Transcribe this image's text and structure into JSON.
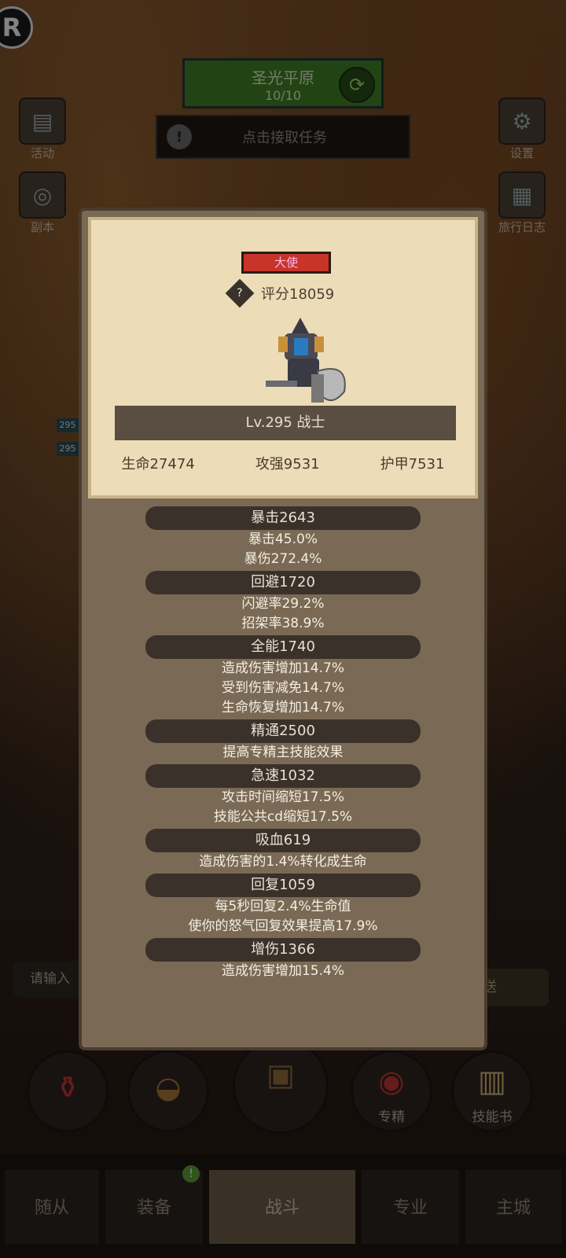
{
  "hud": {
    "zone_name": "圣光平原",
    "zone_progress": "10/10",
    "task_label": "点击接取任务",
    "left_buttons": [
      {
        "label": "活动",
        "icon": "activity-board-icon"
      },
      {
        "label": "副本",
        "icon": "dungeon-portal-icon"
      }
    ],
    "right_buttons": [
      {
        "label": "设置",
        "icon": "gear-icon"
      },
      {
        "label": "旅行日志",
        "icon": "journal-book-icon"
      }
    ],
    "level_tags": [
      "295",
      "295"
    ]
  },
  "chat": {
    "input_placeholder": "请输入",
    "send_label": "送"
  },
  "action_buttons": [
    {
      "label": "",
      "icon": "potion-icon"
    },
    {
      "label": "",
      "icon": "bread-icon"
    },
    {
      "label": "",
      "icon": "treasure-chest-icon"
    },
    {
      "label": "专精",
      "icon": "specialization-icon"
    },
    {
      "label": "技能书",
      "icon": "skill-book-icon"
    }
  ],
  "nav": {
    "tabs": [
      "随从",
      "装备",
      "战斗",
      "专业",
      "主城"
    ],
    "active_tab": "战斗",
    "badge": "!"
  },
  "popup": {
    "rank": "大使",
    "score": "评分18059",
    "level_class": "Lv.295 战士",
    "base_stats": [
      "生命27474",
      "攻强9531",
      "护甲7531"
    ],
    "stats": [
      {
        "header": "暴击2643",
        "lines": [
          "暴击45.0%",
          "暴伤272.4%"
        ]
      },
      {
        "header": "回避1720",
        "lines": [
          "闪避率29.2%",
          "招架率38.9%"
        ]
      },
      {
        "header": "全能1740",
        "lines": [
          "造成伤害增加14.7%",
          "受到伤害减免14.7%",
          "生命恢复增加14.7%"
        ]
      },
      {
        "header": "精通2500",
        "lines": [
          "提高专精主技能效果"
        ]
      },
      {
        "header": "急速1032",
        "lines": [
          "攻击时间缩短17.5%",
          "技能公共cd缩短17.5%"
        ]
      },
      {
        "header": "吸血619",
        "lines": [
          "造成伤害的1.4%转化成生命"
        ]
      },
      {
        "header": "回复1059",
        "lines": [
          "每5秒回复2.4%生命值",
          "使你的怒气回复效果提高17.9%"
        ]
      },
      {
        "header": "增伤1366",
        "lines": [
          "造成伤害增加15.4%"
        ]
      }
    ]
  },
  "colors": {
    "rank_badge": "#c83428",
    "zone_box": "#3f7d25",
    "popup_card": "#ecdcb8"
  }
}
